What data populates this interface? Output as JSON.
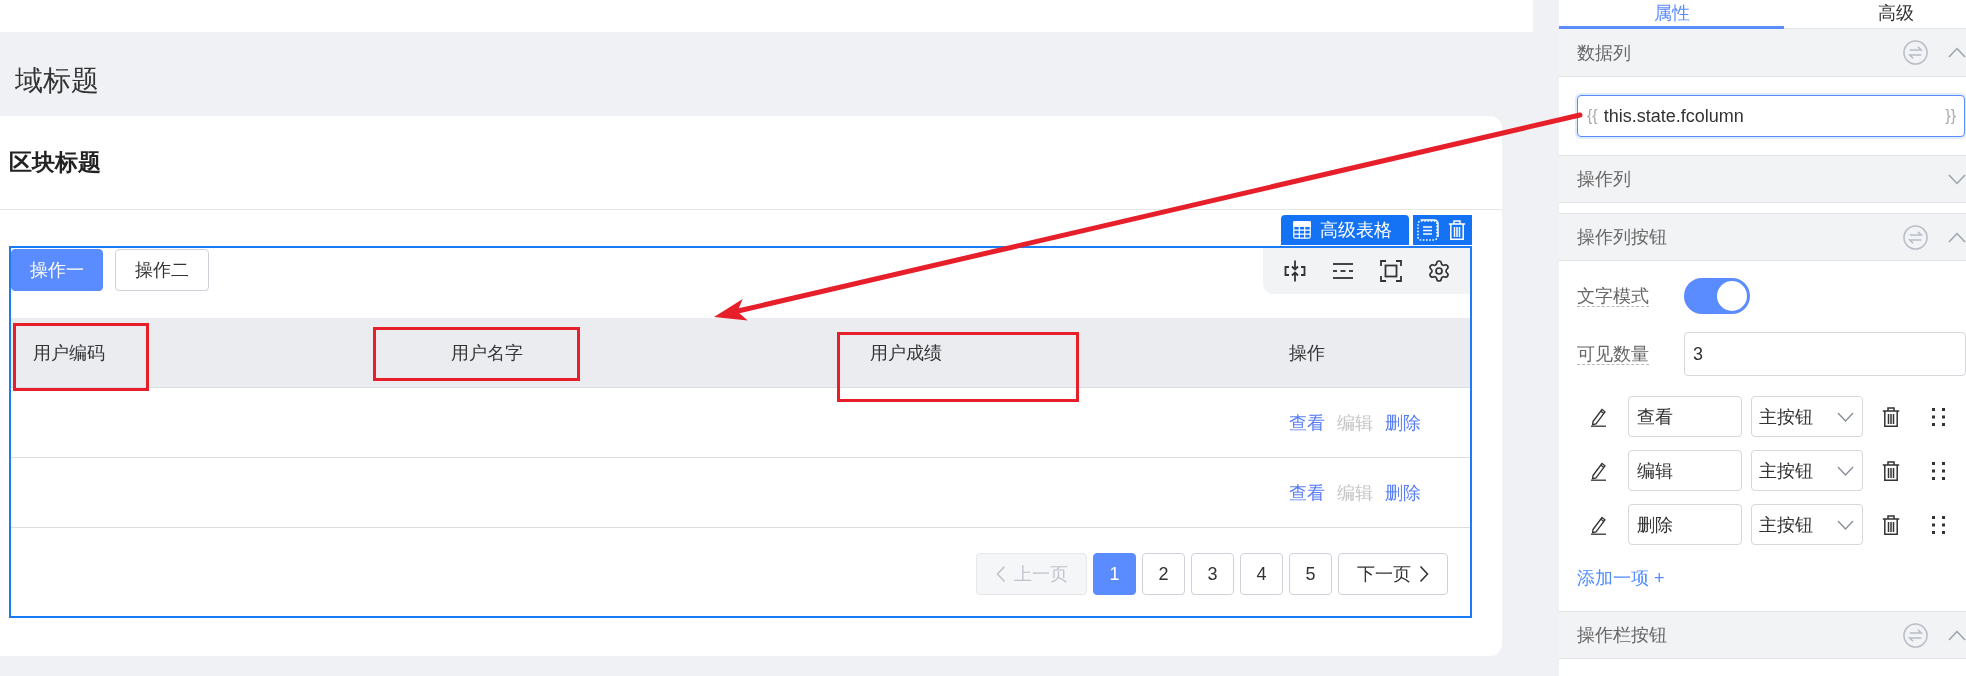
{
  "area_title": "域标题",
  "block": {
    "title": "区块标题"
  },
  "widget": {
    "label": "高级表格",
    "selected": true
  },
  "toolbar_buttons": [
    {
      "label": "操作一",
      "kind": "primary"
    },
    {
      "label": "操作二",
      "kind": "default"
    }
  ],
  "table": {
    "columns": [
      {
        "label": "用户编码",
        "outlined": true
      },
      {
        "label": "用户名字",
        "outlined": true
      },
      {
        "label": "用户成绩",
        "outlined": true
      },
      {
        "label": "操作",
        "outlined": false
      }
    ],
    "rows": [
      {
        "actions": [
          {
            "label": "查看",
            "disabled": false
          },
          {
            "label": "编辑",
            "disabled": true
          },
          {
            "label": "删除",
            "disabled": false
          }
        ]
      },
      {
        "actions": [
          {
            "label": "查看",
            "disabled": false
          },
          {
            "label": "编辑",
            "disabled": true
          },
          {
            "label": "删除",
            "disabled": false
          }
        ]
      }
    ]
  },
  "pagination": {
    "prev": {
      "label": "上一页",
      "disabled": true
    },
    "pages": [
      {
        "label": "1",
        "selected": true
      },
      {
        "label": "2",
        "selected": false
      },
      {
        "label": "3",
        "selected": false
      },
      {
        "label": "4",
        "selected": false
      },
      {
        "label": "5",
        "selected": false
      }
    ],
    "next": {
      "label": "下一页",
      "disabled": false
    }
  },
  "annotation_arrow": true,
  "panel": {
    "tabs": [
      {
        "label": "属性",
        "selected": true
      },
      {
        "label": "高级",
        "selected": false
      }
    ],
    "sections": [
      {
        "title": "数据列",
        "expanded": true,
        "binding_icon": true,
        "kind": "expression",
        "field": {
          "prefix": "{{",
          "value": "this.state.fcolumn",
          "suffix": "}}",
          "focused": true
        }
      },
      {
        "title": "操作列",
        "expanded": false,
        "binding_icon": false,
        "kind": "plain"
      },
      {
        "title": "操作列按钮",
        "expanded": true,
        "binding_icon": true,
        "kind": "buttons",
        "text_mode": {
          "label": "文字模式",
          "on": true
        },
        "visible_count": {
          "label": "可见数量",
          "value": "3"
        },
        "buttons": [
          {
            "text": "查看",
            "type": "主按钮"
          },
          {
            "text": "编辑",
            "type": "主按钮"
          },
          {
            "text": "删除",
            "type": "主按钮"
          }
        ],
        "add_link": "添加一项 +"
      },
      {
        "title": "操作栏按钮",
        "expanded": true,
        "binding_icon": true,
        "kind": "plain"
      }
    ]
  }
}
